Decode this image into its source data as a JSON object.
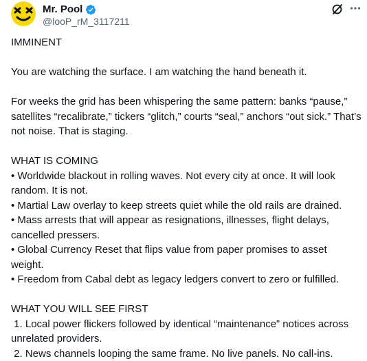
{
  "author": {
    "display_name": "Mr. Pool",
    "handle": "@looP_rM_3117211",
    "verified": true,
    "avatar_icon": "yellow-smiley-face-icon",
    "verified_color": "#1d9bf0"
  },
  "actions": {
    "grok_icon": "grok-icon",
    "more_icon": "more-dots-icon"
  },
  "post": {
    "heading": "IMMINENT",
    "intro": "You are watching the surface. I am watching the hand beneath it.",
    "paragraph": "For weeks the grid has been whispering the same pattern: banks “pause,” satellites “recalibrate,” tickers “glitch,” courts “seal,” anchors “out sick.” That’s not noise. That is staging.",
    "section1": {
      "title": "WHAT IS COMING",
      "items": [
        "• Worldwide blackout in rolling waves. Not every city at once. It will look random. It is not.",
        "• Martial Law overlay to keep streets quiet while the old rails are drained.",
        "• Mass arrests that will appear as resignations, illnesses, flight delays, cancelled pressers.",
        "• Global Currency Reset that flips value from paper promises to asset weight.",
        "• Freedom from Cabal debt as legacy ledgers convert to zero or fulfilled."
      ]
    },
    "section2": {
      "title": "WHAT YOU WILL SEE FIRST",
      "items": [
        " 1. Local power flickers followed by identical “maintenance” notices across unrelated providers.",
        " 2. News channels looping the same frame. No live panels. No call-ins."
      ]
    }
  }
}
